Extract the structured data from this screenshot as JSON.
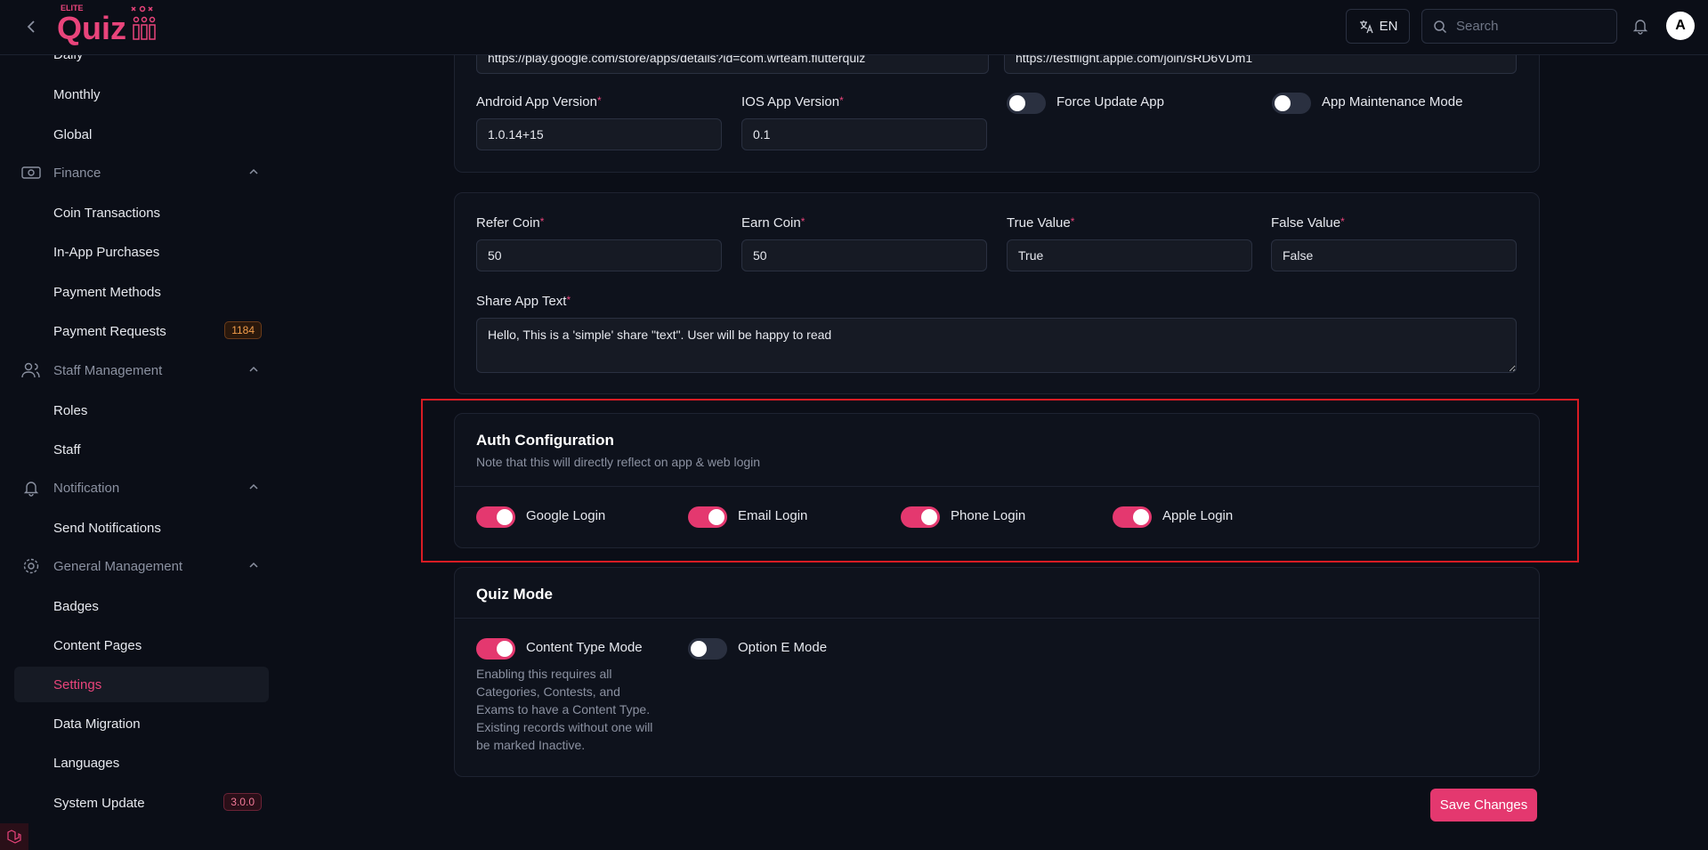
{
  "topbar": {
    "logo_small": "ELITE",
    "logo_main": "Quiz",
    "language": "EN",
    "search_placeholder": "Search",
    "avatar_initial": "A"
  },
  "sidebar": {
    "items": [
      {
        "label": "Daily"
      },
      {
        "label": "Monthly"
      },
      {
        "label": "Global"
      },
      {
        "label": "Finance",
        "group": true,
        "icon": "banknote-icon"
      },
      {
        "label": "Coin Transactions"
      },
      {
        "label": "In-App Purchases"
      },
      {
        "label": "Payment Methods"
      },
      {
        "label": "Payment Requests",
        "badge": "1184"
      },
      {
        "label": "Staff Management",
        "group": true,
        "icon": "users-icon"
      },
      {
        "label": "Roles"
      },
      {
        "label": "Staff"
      },
      {
        "label": "Notification",
        "group": true,
        "icon": "bell-icon"
      },
      {
        "label": "Send Notifications"
      },
      {
        "label": "General Management",
        "group": true,
        "icon": "gear-icon"
      },
      {
        "label": "Badges"
      },
      {
        "label": "Content Pages"
      },
      {
        "label": "Settings",
        "active": true
      },
      {
        "label": "Data Migration"
      },
      {
        "label": "Languages"
      },
      {
        "label": "System Update",
        "badge": "3.0.0"
      }
    ]
  },
  "app_card": {
    "android_link": "https://play.google.com/store/apps/details?id=com.wrteam.flutterquiz",
    "ios_link": "https://testflight.apple.com/join/sRD6VDm1",
    "android_version_label": "Android App Version",
    "android_version_value": "1.0.14+15",
    "ios_version_label": "IOS App Version",
    "ios_version_value": "0.1",
    "force_update_label": "Force Update App",
    "maintenance_label": "App Maintenance Mode"
  },
  "coin_card": {
    "refer_coin_label": "Refer Coin",
    "refer_coin_value": "50",
    "earn_coin_label": "Earn Coin",
    "earn_coin_value": "50",
    "true_value_label": "True Value",
    "true_value_value": "True",
    "false_value_label": "False Value",
    "false_value_value": "False",
    "share_text_label": "Share App Text",
    "share_text_value": "Hello, This is a 'simple' share \"text\". User will be happy to read"
  },
  "auth_card": {
    "title": "Auth Configuration",
    "subtitle": "Note that this will directly reflect on app & web login",
    "google_label": "Google Login",
    "email_label": "Email Login",
    "phone_label": "Phone Login",
    "apple_label": "Apple Login"
  },
  "quiz_mode_card": {
    "title": "Quiz Mode",
    "content_type_label": "Content Type Mode",
    "option_e_label": "Option E Mode",
    "note_line1": "Enabling this requires all",
    "note_line2": "Categories, Contests, and",
    "note_line3": "Exams to have a Content Type.",
    "note_line4": "Existing records without one will",
    "note_line5": "be marked Inactive."
  },
  "save_label": "Save Changes",
  "colors": {
    "accent": "#e4386f",
    "highlight_border": "#d91c24",
    "background": "#0b0e17"
  }
}
